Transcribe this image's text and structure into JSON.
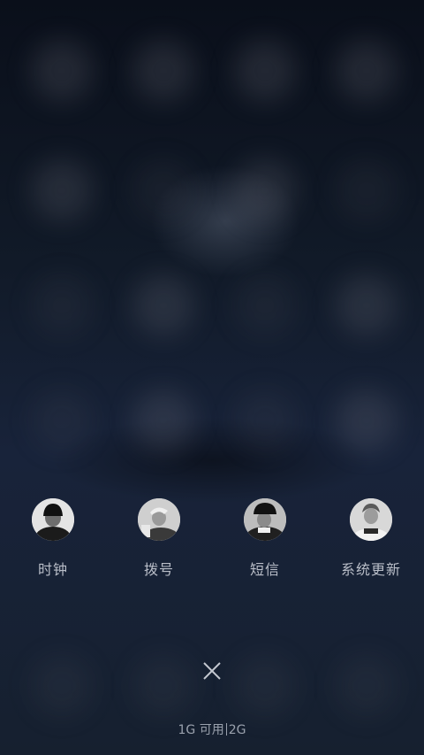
{
  "recent_apps": [
    {
      "label": "时钟",
      "icon": "person-beanie-photo-icon"
    },
    {
      "label": "拨号",
      "icon": "person-photo-icon"
    },
    {
      "label": "短信",
      "icon": "person-hat-photo-icon"
    },
    {
      "label": "系统更新",
      "icon": "person-photo-icon"
    }
  ],
  "close": {
    "icon": "close-icon"
  },
  "memory": {
    "available": "1G 可用",
    "total": "2G"
  }
}
